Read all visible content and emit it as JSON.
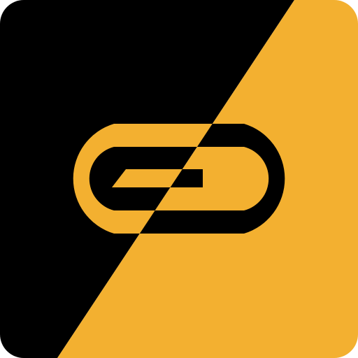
{
  "icon": {
    "name": "app-logo-icon",
    "colors": {
      "dark": "#000000",
      "accent": "#F3B030"
    }
  }
}
